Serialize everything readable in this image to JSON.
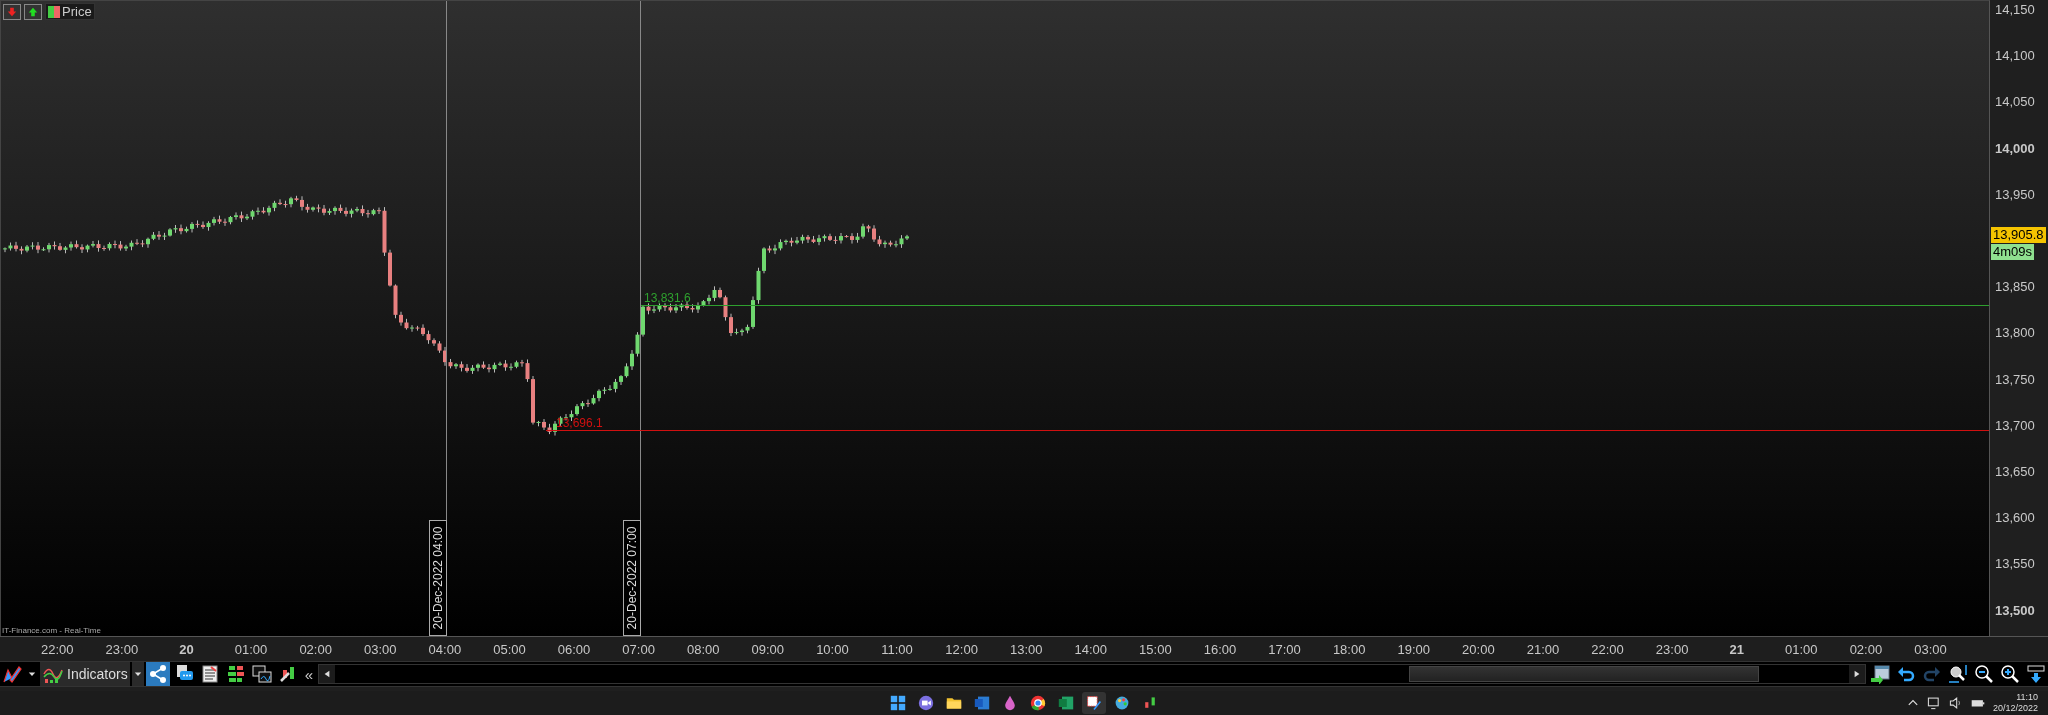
{
  "legend": {
    "label": "Price"
  },
  "source_note": "IT-Finance.com - Real-Time",
  "price_axis": [
    {
      "label": "14,150",
      "bold": false
    },
    {
      "label": "14,100",
      "bold": false
    },
    {
      "label": "14,050",
      "bold": false
    },
    {
      "label": "14,000",
      "bold": true
    },
    {
      "label": "13,950",
      "bold": false
    },
    {
      "label": "13,850",
      "bold": false
    },
    {
      "label": "13,800",
      "bold": false
    },
    {
      "label": "13,750",
      "bold": false
    },
    {
      "label": "13,700",
      "bold": false
    },
    {
      "label": "13,650",
      "bold": false
    },
    {
      "label": "13,600",
      "bold": false
    },
    {
      "label": "13,550",
      "bold": false
    },
    {
      "label": "13,500",
      "bold": true
    }
  ],
  "current_price": "13,905.8",
  "countdown": "4m09s",
  "levels": [
    {
      "label": "13,831.6",
      "color": "#2ea02e"
    },
    {
      "label": "13,696.1",
      "color": "#d01010"
    }
  ],
  "markers": [
    {
      "label": "20-Dec-2022 04:00"
    },
    {
      "label": "20-Dec-2022 07:00"
    }
  ],
  "time_axis": [
    {
      "label": "22:00",
      "bold": false
    },
    {
      "label": "23:00",
      "bold": false
    },
    {
      "label": "20",
      "bold": true
    },
    {
      "label": "01:00",
      "bold": false
    },
    {
      "label": "02:00",
      "bold": false
    },
    {
      "label": "03:00",
      "bold": false
    },
    {
      "label": "04:00",
      "bold": false
    },
    {
      "label": "05:00",
      "bold": false
    },
    {
      "label": "06:00",
      "bold": false
    },
    {
      "label": "07:00",
      "bold": false
    },
    {
      "label": "08:00",
      "bold": false
    },
    {
      "label": "09:00",
      "bold": false
    },
    {
      "label": "10:00",
      "bold": false
    },
    {
      "label": "11:00",
      "bold": false
    },
    {
      "label": "12:00",
      "bold": false
    },
    {
      "label": "13:00",
      "bold": false
    },
    {
      "label": "14:00",
      "bold": false
    },
    {
      "label": "15:00",
      "bold": false
    },
    {
      "label": "16:00",
      "bold": false
    },
    {
      "label": "17:00",
      "bold": false
    },
    {
      "label": "18:00",
      "bold": false
    },
    {
      "label": "19:00",
      "bold": false
    },
    {
      "label": "20:00",
      "bold": false
    },
    {
      "label": "21:00",
      "bold": false
    },
    {
      "label": "22:00",
      "bold": false
    },
    {
      "label": "23:00",
      "bold": false
    },
    {
      "label": "21",
      "bold": true
    },
    {
      "label": "01:00",
      "bold": false
    },
    {
      "label": "02:00",
      "bold": false
    },
    {
      "label": "03:00",
      "bold": false
    }
  ],
  "toolbar": {
    "indicators": "Indicators",
    "collapse": "«"
  },
  "taskbar": {
    "time": "11:10",
    "date": "20/12/2022"
  }
}
